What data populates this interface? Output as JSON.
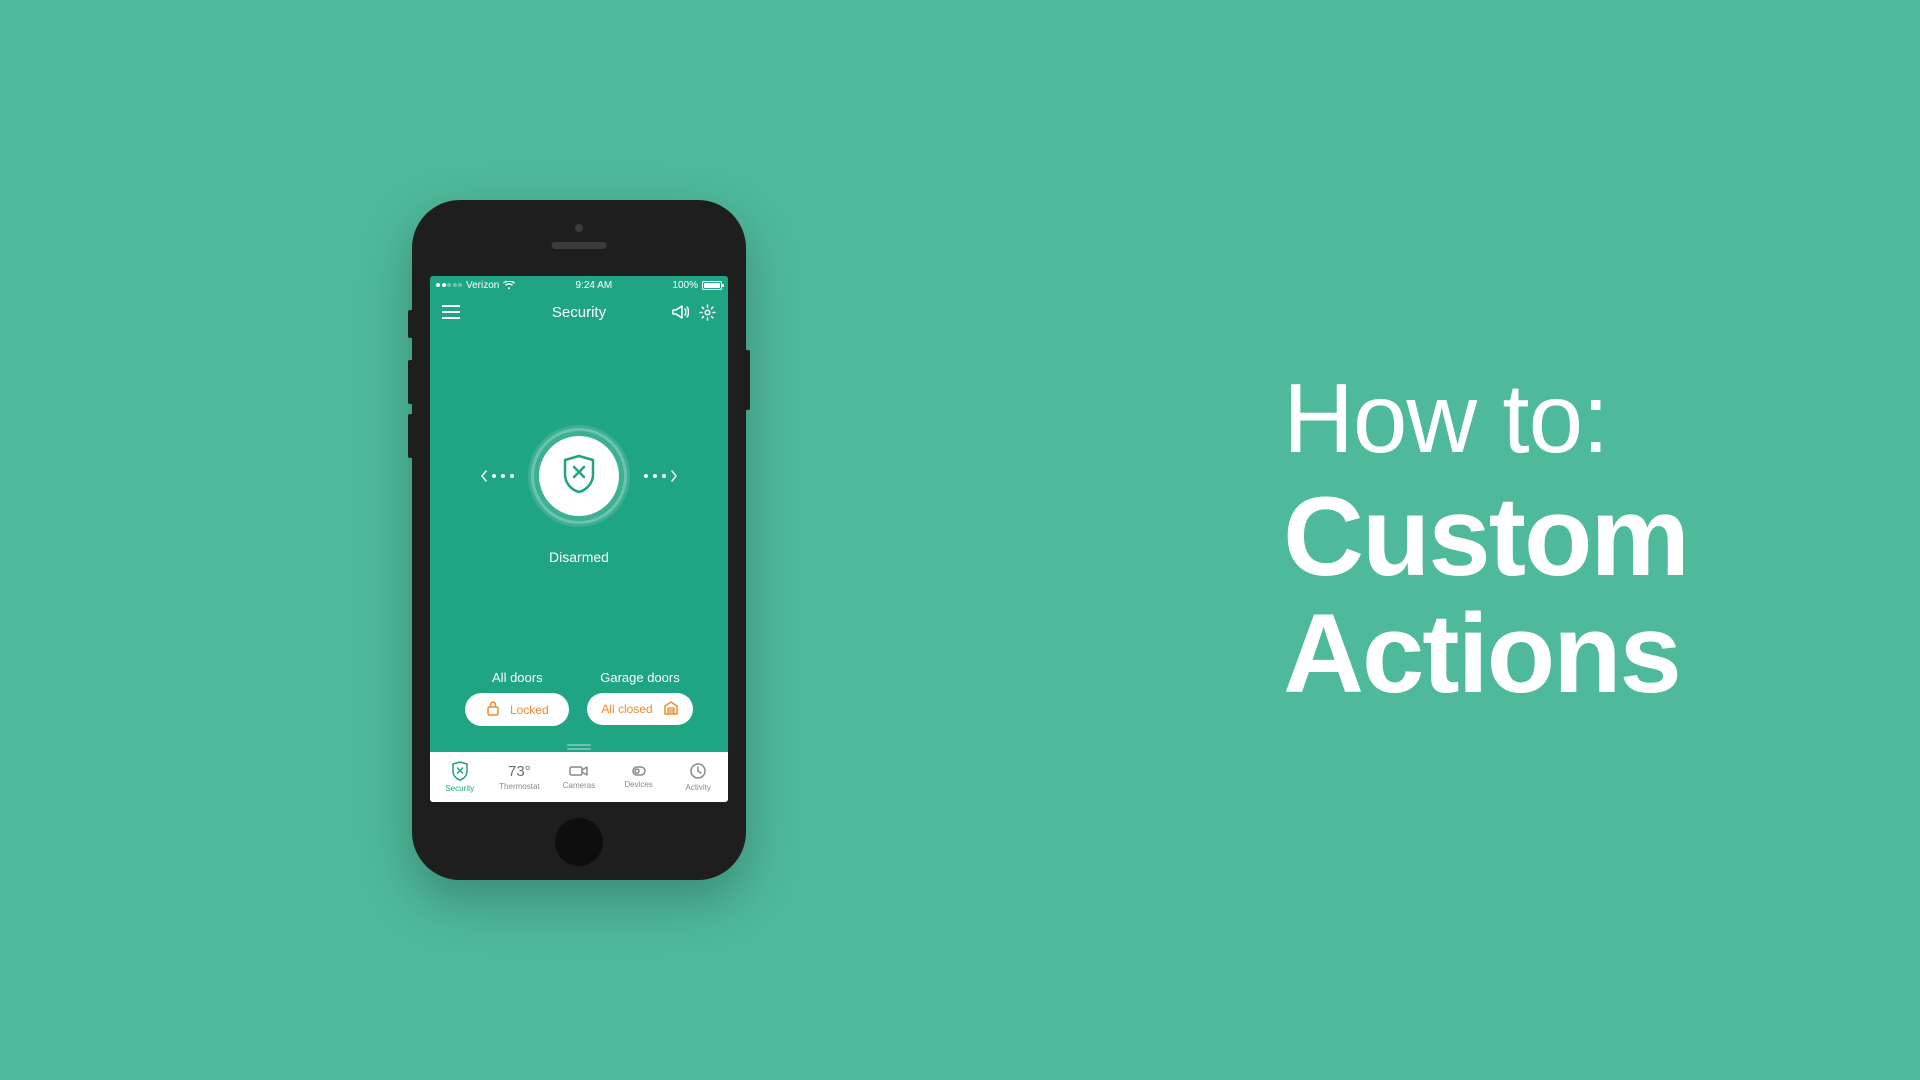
{
  "headline": {
    "line1": "How to:",
    "line2": "Custom",
    "line3": "Actions"
  },
  "colors": {
    "background": "#4fb99c",
    "screen": "#20a584",
    "accent_orange": "#f08a2c",
    "tab_active": "#1fa383"
  },
  "status_bar": {
    "carrier": "Verizon",
    "time": "9:24 AM",
    "battery_pct": "100%"
  },
  "nav": {
    "title": "Security"
  },
  "arm": {
    "status": "Disarmed"
  },
  "door_groups": [
    {
      "title": "All doors",
      "pill_label": "Locked",
      "icon": "lock"
    },
    {
      "title": "Garage doors",
      "pill_label": "All closed",
      "icon": "garage"
    }
  ],
  "tabs": [
    {
      "label": "Security",
      "icon": "shield-x",
      "active": true
    },
    {
      "label": "Thermostat",
      "icon": "thermostat",
      "temp": "73°",
      "active": false
    },
    {
      "label": "Cameras",
      "icon": "camera",
      "active": false
    },
    {
      "label": "Devices",
      "icon": "device",
      "active": false
    },
    {
      "label": "Activity",
      "icon": "clock",
      "active": false
    }
  ]
}
